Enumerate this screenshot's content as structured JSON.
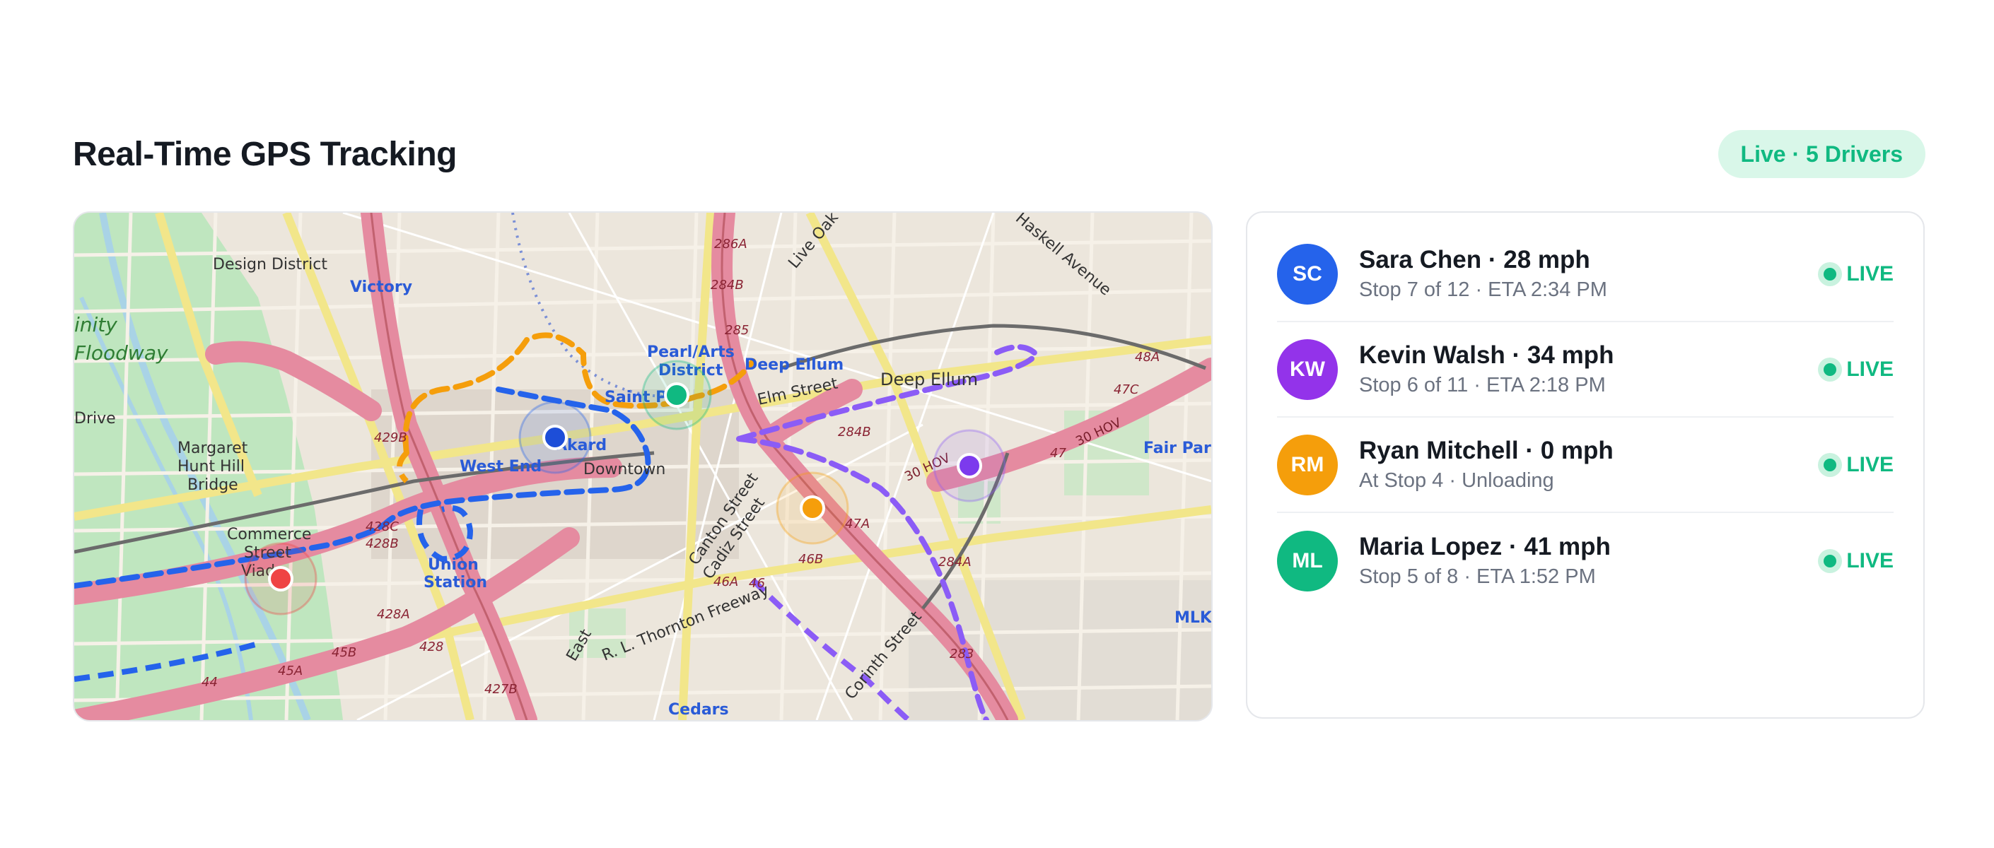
{
  "page": {
    "title": "Real-Time GPS Tracking",
    "live_badge": "Live · 5 Drivers"
  },
  "map": {
    "labels": {
      "design_district": "Design District",
      "victory": "Victory",
      "trinity_floodway_1": "inity",
      "trinity_floodway_2": "Floodway",
      "drive": "Drive",
      "margaret_1": "Margaret",
      "margaret_2": "Hunt Hill",
      "margaret_3": "Bridge",
      "west_end": "West End",
      "akard": "Akard",
      "downtown": "Downtown",
      "pearl_1": "Pearl/Arts",
      "pearl_2": "District",
      "saint_paul": "Saint Pa",
      "deep_ellum_station": "Deep Ellum",
      "deep_ellum": "Deep Ellum",
      "elm_street": "Elm Street",
      "live_oak": "Live Oak Street",
      "haskell": "Haskell Avenue",
      "fair_park": "Fair Park",
      "commerce_1": "Commerce",
      "commerce_2": "Street",
      "commerce_3": "Viad",
      "union_1": "Union",
      "union_2": "Station",
      "canton": "Canton Street",
      "cadiz": "Cadiz Street",
      "thornton": "R. L. Thornton Freeway",
      "east": "East",
      "corinth": "Corinth Street",
      "cedars": "Cedars",
      "mlk": "MLK",
      "hov_1": "30 HOV",
      "hov_2": "30 HOV",
      "exit_286a": "286A",
      "exit_284b": "284B",
      "exit_285": "285",
      "exit_429b": "429B",
      "exit_428c": "428C",
      "exit_428b": "428B",
      "exit_428a": "428A",
      "exit_428": "428",
      "exit_45b": "45B",
      "exit_45a": "45A",
      "exit_44": "44",
      "exit_427b": "427B",
      "exit_47a": "47A",
      "exit_46b": "46B",
      "exit_46a": "46A",
      "exit_46": "46",
      "exit_47": "47",
      "exit_47c": "47C",
      "exit_48a": "48A",
      "exit_284a": "284A",
      "exit_283": "283",
      "exit_284b2": "284B"
    },
    "route_colors": {
      "blue": "#1d4ed8",
      "orange": "#f59e0b",
      "purple": "#8b5cf6",
      "red": "#ef4444",
      "green": "#10b981"
    }
  },
  "drivers": [
    {
      "initials": "SC",
      "name_speed": "Sara Chen · 28 mph",
      "status": "Stop 7 of 12 · ETA 2:34 PM",
      "live": "LIVE",
      "color": "#2563eb"
    },
    {
      "initials": "KW",
      "name_speed": "Kevin Walsh · 34 mph",
      "status": "Stop 6 of 11 · ETA 2:18 PM",
      "live": "LIVE",
      "color": "#9333ea"
    },
    {
      "initials": "RM",
      "name_speed": "Ryan Mitchell · 0 mph",
      "status": "At Stop 4 · Unloading",
      "live": "LIVE",
      "color": "#f59e0b"
    },
    {
      "initials": "ML",
      "name_speed": "Maria Lopez · 41 mph",
      "status": "Stop 5 of 8 · ETA 1:52 PM",
      "live": "LIVE",
      "color": "#10b981"
    }
  ]
}
